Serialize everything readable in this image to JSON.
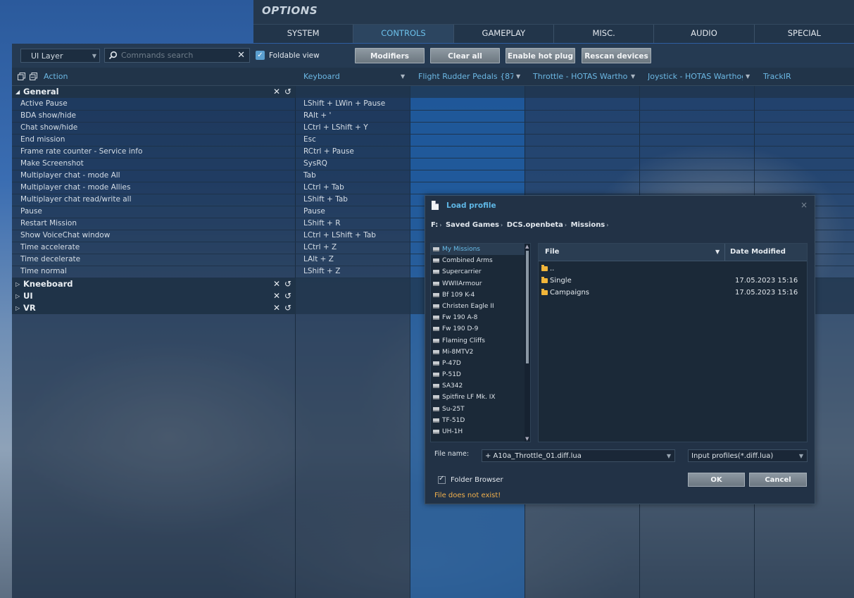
{
  "header": {
    "title": "OPTIONS"
  },
  "tabs": [
    {
      "label": "SYSTEM",
      "active": false
    },
    {
      "label": "CONTROLS",
      "active": true
    },
    {
      "label": "GAMEPLAY",
      "active": false
    },
    {
      "label": "MISC.",
      "active": false
    },
    {
      "label": "AUDIO",
      "active": false
    },
    {
      "label": "SPECIAL",
      "active": false
    }
  ],
  "toolbar": {
    "layer_select": "UI Layer",
    "search_placeholder": "Commands search",
    "foldable_label": "Foldable view",
    "foldable_checked": true,
    "modifiers": "Modifiers",
    "clear_all": "Clear all",
    "hot_plug": "Enable hot plug",
    "rescan": "Rescan devices"
  },
  "columns": {
    "action": "Action",
    "keyboard": "Keyboard",
    "rudder": "Flight Rudder Pedals {873...",
    "throttle": "Throttle - HOTAS Warthog ...",
    "joystick": "Joystick - HOTAS Warthog {...",
    "trackir": "TrackIR"
  },
  "categories": {
    "general": "General",
    "kneeboard": "Kneeboard",
    "ui": "UI",
    "vr": "VR"
  },
  "general_rows": [
    {
      "action": "Active Pause",
      "keyboard": "LShift + LWin + Pause"
    },
    {
      "action": "BDA show/hide",
      "keyboard": "RAlt + '"
    },
    {
      "action": "Chat show/hide",
      "keyboard": "LCtrl + LShift + Y"
    },
    {
      "action": "End mission",
      "keyboard": "Esc"
    },
    {
      "action": "Frame rate counter - Service info",
      "keyboard": "RCtrl + Pause"
    },
    {
      "action": "Make Screenshot",
      "keyboard": "SysRQ"
    },
    {
      "action": "Multiplayer chat - mode All",
      "keyboard": "Tab"
    },
    {
      "action": "Multiplayer chat - mode Allies",
      "keyboard": "LCtrl + Tab"
    },
    {
      "action": "Multiplayer chat read/write all",
      "keyboard": "LShift + Tab"
    },
    {
      "action": "Pause",
      "keyboard": "Pause"
    },
    {
      "action": "Restart Mission",
      "keyboard": "LShift + R"
    },
    {
      "action": "Show VoiceChat window",
      "keyboard": "LCtrl + LShift + Tab"
    },
    {
      "action": "Time accelerate",
      "keyboard": "LCtrl + Z"
    },
    {
      "action": "Time decelerate",
      "keyboard": "LAlt + Z"
    },
    {
      "action": "Time normal",
      "keyboard": "LShift + Z"
    }
  ],
  "dialog": {
    "title": "Load profile",
    "close_icon": "×",
    "path": [
      "F:",
      "Saved Games",
      "DCS.openbeta",
      "Missions"
    ],
    "folders": [
      "My Missions",
      "Combined Arms",
      "Supercarrier",
      "WWIIArmour",
      "Bf 109 K-4",
      "Christen Eagle II",
      "Fw 190 A-8",
      "Fw 190 D-9",
      "Flaming Cliffs",
      "Mi-8MTV2",
      "P-47D",
      "P-51D",
      "SA342",
      "Spitfire LF Mk. IX",
      "Su-25T",
      "TF-51D",
      "UH-1H"
    ],
    "file_col": "File",
    "date_col": "Date Modified",
    "files": [
      {
        "name": "..",
        "date": ""
      },
      {
        "name": "Single",
        "date": "17.05.2023 15:16"
      },
      {
        "name": "Campaigns",
        "date": "17.05.2023 15:16"
      }
    ],
    "file_name_label": "File name:",
    "file_name_value": "+ A10a_Throttle_01.diff.lua",
    "file_type": "Input profiles(*.diff.lua)",
    "folder_browser": "Folder Browser",
    "ok": "OK",
    "cancel": "Cancel",
    "error": "File does not exist!"
  }
}
